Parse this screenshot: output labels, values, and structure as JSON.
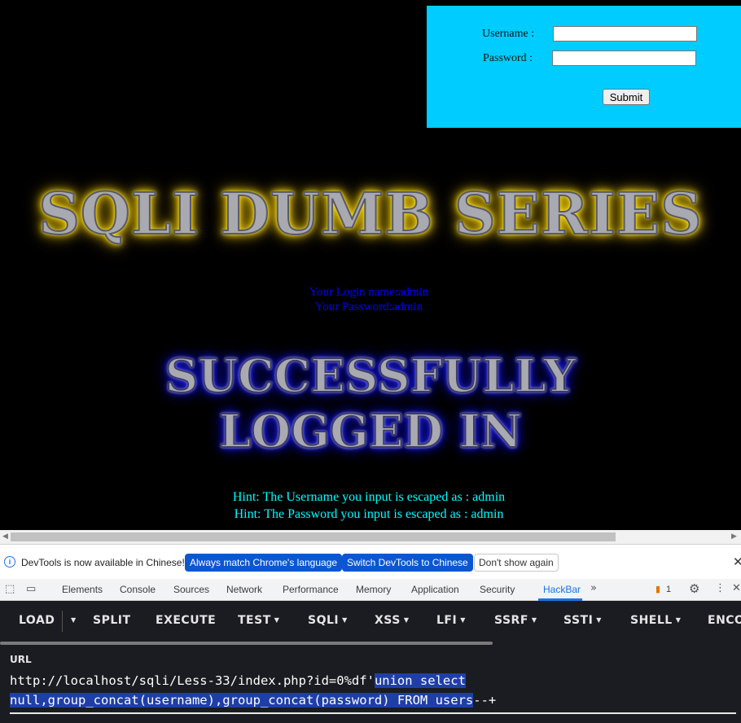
{
  "login_form": {
    "username_label": "Username :",
    "password_label": "Password :",
    "username_value": "",
    "password_value": "",
    "submit_label": "Submit"
  },
  "page": {
    "title": "SQLI DUMB SERIES",
    "login_name_line": "Your Login name:admin",
    "password_line": "Your Password:admin",
    "success_line1": "SUCCESSFULLY",
    "success_line2": "LOGGED IN",
    "hint_username": "Hint: The Username you input is escaped as : admin",
    "hint_password": "Hint: The Password you input is escaped as : admin"
  },
  "devtools": {
    "notice": {
      "text": "DevTools is now available in Chinese!",
      "btn_match": "Always match Chrome's language",
      "btn_switch": "Switch DevTools to Chinese",
      "btn_dismiss": "Don't show again"
    },
    "tabs": [
      "Elements",
      "Console",
      "Sources",
      "Network",
      "Performance",
      "Memory",
      "Application",
      "Security",
      "HackBar"
    ],
    "active_tab": "HackBar",
    "issues_count": "1"
  },
  "hackbar": {
    "buttons": [
      "LOAD",
      "SPLIT",
      "EXECUTE",
      "TEST",
      "SQLI",
      "XSS",
      "LFI",
      "SSRF",
      "SSTI",
      "SHELL",
      "ENCO"
    ],
    "url_label": "URL",
    "url_plain": "http://localhost/sqli/Less-33/index.php?id=0%df'",
    "url_selected_1": "union select ",
    "url_selected_2": "null,group_concat(username),group_concat(password) FROM users",
    "url_tail": "--+"
  },
  "colors": {
    "login_bg": "#00ccff",
    "title_glow": "#ffe600",
    "success_glow": "#2222ee",
    "login_info": "#0000ff",
    "hint": "#00ffff",
    "devtools_accent": "#1a73e8",
    "hackbar_bg": "#1a1c21"
  },
  "icons": [
    "info-icon",
    "inspect-icon",
    "device-toggle-icon",
    "more-tabs-icon",
    "issues-icon",
    "settings-gear-icon",
    "kebab-menu-icon",
    "close-icon",
    "caret-down-icon"
  ]
}
